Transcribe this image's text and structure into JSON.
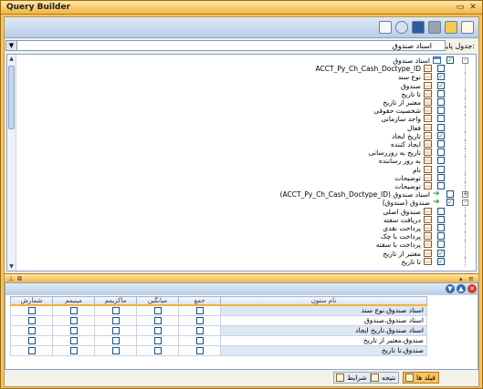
{
  "window": {
    "title": "Query Builder"
  },
  "base_table": {
    "label": "جدول پایه:",
    "selected": "اسناد صندوق"
  },
  "tree_rows": [
    {
      "text": "اسناد صندوق",
      "icon": "table-icon",
      "checked": true,
      "expander": "-"
    },
    {
      "text": "ACCT_Py_Ch_Cash_Doctype_ID",
      "icon": "field-icon",
      "checked": false
    },
    {
      "text": "نوع سند",
      "icon": "field-icon",
      "checked": true
    },
    {
      "text": "صندوق",
      "icon": "field-icon",
      "checked": true
    },
    {
      "text": "تا تاریخ",
      "icon": "field-icon",
      "checked": false
    },
    {
      "text": "معتبر از تاریخ",
      "icon": "field-icon",
      "checked": false
    },
    {
      "text": "شخصیت حقوقی",
      "icon": "field-icon",
      "checked": false
    },
    {
      "text": "واحد سازمانی",
      "icon": "field-icon",
      "checked": false
    },
    {
      "text": "فعال",
      "icon": "field-icon",
      "checked": false
    },
    {
      "text": "تاریخ ایجاد",
      "icon": "field-icon",
      "checked": true
    },
    {
      "text": "ایجاد کننده",
      "icon": "field-icon",
      "checked": false
    },
    {
      "text": "تاریخ به روزرسانی",
      "icon": "field-icon",
      "checked": false
    },
    {
      "text": "به روز رساننده",
      "icon": "field-icon",
      "checked": false
    },
    {
      "text": "نام",
      "icon": "field-icon",
      "checked": false
    },
    {
      "text": "توضیحات",
      "icon": "field-icon",
      "checked": false
    },
    {
      "text": "توضیحات",
      "icon": "field-icon",
      "checked": false
    },
    {
      "text": "(ACCT_Py_Ch_Cash_Doctype_ID) اسناد صندوق",
      "icon": "arrow-icon",
      "checked": false,
      "expander": "+"
    },
    {
      "text": "(صندوق) صندوق",
      "icon": "arrow-icon",
      "checked": true,
      "expander": "-"
    },
    {
      "text": "صندوق اصلی",
      "icon": "field-icon",
      "checked": false
    },
    {
      "text": "دریافت سفته",
      "icon": "field-icon",
      "checked": false
    },
    {
      "text": "پرداخت نقدی",
      "icon": "field-icon",
      "checked": false
    },
    {
      "text": "پرداخت با چک",
      "icon": "field-icon",
      "checked": false
    },
    {
      "text": "پرداخت با سفته",
      "icon": "field-icon",
      "checked": false
    },
    {
      "text": "معتبر از تاریخ",
      "icon": "field-icon",
      "checked": true
    },
    {
      "text": "تا تاریخ",
      "icon": "field-icon",
      "checked": true
    }
  ],
  "field_grid": {
    "columns": [
      "نام ستون",
      "جمع",
      "میانگین",
      "ماکزیمم",
      "مینیمم",
      "شمارش"
    ],
    "rows": [
      "اسناد صندوق.نوع سند",
      "اسناد صندوق.صندوق",
      "اسناد صندوق.تاریخ ایجاد",
      "صندوق.معتبر از تاریخ",
      "صندوق.تا تاریخ"
    ]
  },
  "bottom_tabs": [
    {
      "label": "فیلد ها",
      "active": true
    },
    {
      "label": "نتیجه",
      "active": false
    },
    {
      "label": "شرایط",
      "active": false
    }
  ]
}
